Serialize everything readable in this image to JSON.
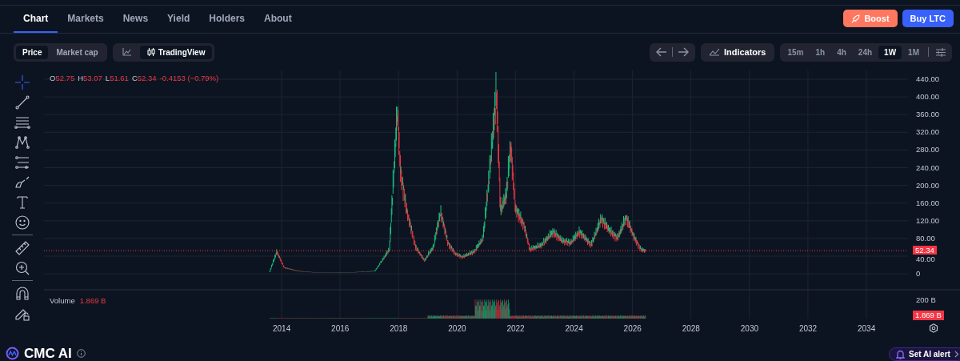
{
  "tabs": [
    {
      "label": "Chart",
      "selected": true
    },
    {
      "label": "Markets",
      "selected": false
    },
    {
      "label": "News",
      "selected": false
    },
    {
      "label": "Yield",
      "selected": false
    },
    {
      "label": "Holders",
      "selected": false
    },
    {
      "label": "About",
      "selected": false
    }
  ],
  "actions": [
    {
      "label": "Boost",
      "kind": "boost"
    },
    {
      "label": "Buy LTC",
      "kind": "buy"
    }
  ],
  "metric_toggle": [
    {
      "label": "Price",
      "selected": true
    },
    {
      "label": "Market cap",
      "selected": false
    }
  ],
  "chart_type": [
    {
      "kind": "line",
      "selected": false
    },
    {
      "kind": "tradingview",
      "label": "TradingView",
      "selected": true
    }
  ],
  "indicators": {
    "label": "Indicators"
  },
  "intervals": [
    {
      "label": "15m",
      "selected": false
    },
    {
      "label": "1h",
      "selected": false
    },
    {
      "label": "4h",
      "selected": false
    },
    {
      "label": "24h",
      "selected": false
    },
    {
      "label": "1W",
      "selected": true
    },
    {
      "label": "1M",
      "selected": false
    }
  ],
  "legend": [
    {
      "key": "O",
      "value": "52.75"
    },
    {
      "key": "H",
      "value": "53.07"
    },
    {
      "key": "L",
      "value": "51.61"
    },
    {
      "key": "C",
      "value": "52.34"
    }
  ],
  "legend_change": "-0.4153 (−0.79%)",
  "price_axis": [
    "440.00",
    "400.00",
    "360.00",
    "320.00",
    "280.00",
    "240.00",
    "200.00",
    "160.00",
    "120.00",
    "80.00",
    "40.00",
    "0"
  ],
  "price_tag": "52.34",
  "volume_legend": {
    "label": "Volume",
    "value": "1.869 B"
  },
  "volume_axis": "200 B",
  "volume_tag": "1.869 B",
  "time_axis": [
    "2014",
    "2016",
    "2018",
    "2020",
    "2022",
    "2024",
    "2026",
    "2028",
    "2030",
    "2032",
    "2034"
  ],
  "footer": {
    "title": "CMC AI",
    "alert_button": "Set AI alert"
  }
}
